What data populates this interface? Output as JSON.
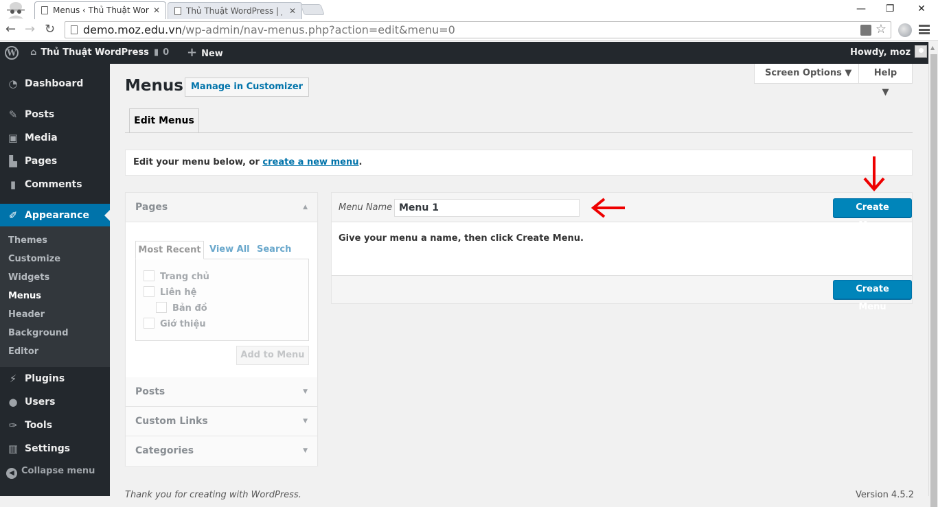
{
  "browser": {
    "tabs": [
      {
        "title": "Menus ‹ Thủ Thuật WordP",
        "close": "✕",
        "active": true
      },
      {
        "title": "Thủ Thuật WordPress | Jus",
        "close": "✕",
        "active": false
      }
    ],
    "url_host": "demo.moz.edu.vn",
    "url_path": "/wp-admin/nav-menus.php?action=edit&menu=0",
    "window_controls": {
      "minimize": "—",
      "restore": "❐",
      "close": "✕"
    }
  },
  "adminbar": {
    "site_name": "Thủ Thuật WordPress",
    "comments_count": "0",
    "new_label": "New",
    "greeting": "Howdy, moz"
  },
  "sidebar": {
    "items": [
      {
        "label": "Dashboard",
        "icon": "dashboard-icon"
      },
      {
        "label": "Posts",
        "icon": "pin-icon"
      },
      {
        "label": "Media",
        "icon": "media-icon"
      },
      {
        "label": "Pages",
        "icon": "pages-icon"
      },
      {
        "label": "Comments",
        "icon": "comment-icon"
      },
      {
        "label": "Appearance",
        "icon": "brush-icon",
        "current": true
      },
      {
        "label": "Plugins",
        "icon": "plug-icon"
      },
      {
        "label": "Users",
        "icon": "user-icon"
      },
      {
        "label": "Tools",
        "icon": "wrench-icon"
      },
      {
        "label": "Settings",
        "icon": "sliders-icon"
      }
    ],
    "submenu": [
      "Themes",
      "Customize",
      "Widgets",
      "Menus",
      "Header",
      "Background",
      "Editor"
    ],
    "submenu_current": "Menus",
    "collapse_label": "Collapse menu"
  },
  "header": {
    "screen_options": "Screen Options ▼",
    "help": "Help ▼"
  },
  "main": {
    "title": "Menus",
    "manage_customizer": "Manage in Customizer",
    "tab_edit_menus": "Edit Menus",
    "notice_prefix": "Edit your menu below, or ",
    "notice_link": "create a new menu",
    "notice_suffix": "."
  },
  "metaboxes": {
    "pages": {
      "title": "Pages",
      "tabs": [
        "Most Recent",
        "View All",
        "Search"
      ],
      "items": [
        {
          "label": "Trang chủ",
          "checked": false,
          "indent": 0
        },
        {
          "label": "Liên hệ",
          "checked": false,
          "indent": 0
        },
        {
          "label": "Bản đồ",
          "checked": false,
          "indent": 1
        },
        {
          "label": "Giớ thiệu",
          "checked": false,
          "indent": 0
        }
      ],
      "add_button": "Add to Menu"
    },
    "collapsed": [
      "Posts",
      "Custom Links",
      "Categories"
    ]
  },
  "menu_editor": {
    "name_label": "Menu Name",
    "name_value": "Menu 1",
    "create_button": "Create Menu",
    "instructions": "Give your menu a name, then click Create Menu."
  },
  "footer": {
    "thanks": "Thank you for creating with WordPress.",
    "version": "Version 4.5.2"
  },
  "colors": {
    "accent": "#0073aa",
    "primary_button": "#0085ba",
    "adminbar": "#23282d",
    "annotation_arrow": "#ee0000"
  }
}
